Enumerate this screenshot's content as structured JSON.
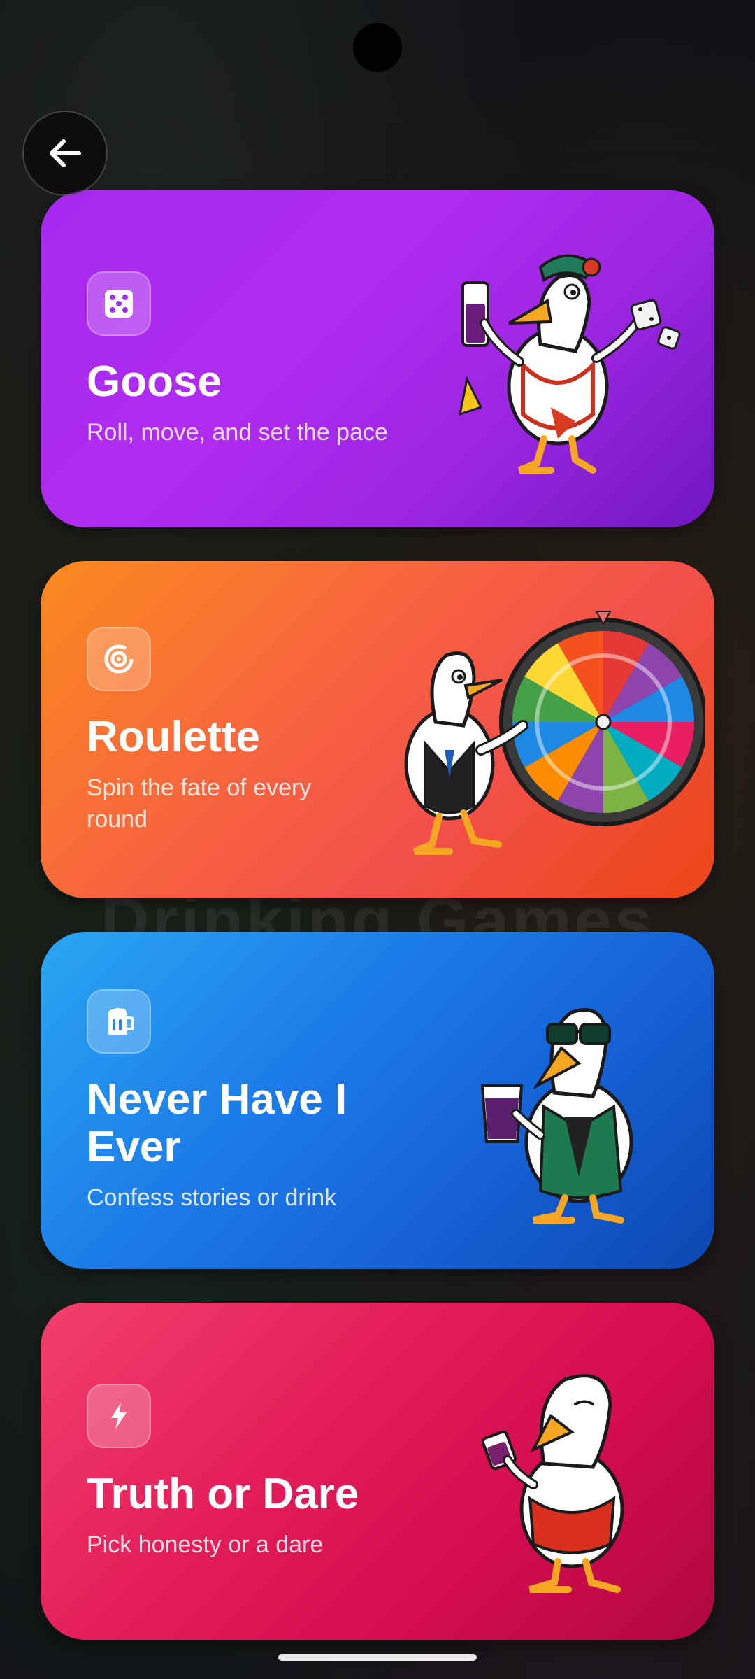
{
  "background_title": "Drinking Games",
  "back_button": {
    "icon": "arrow-left-icon"
  },
  "games": [
    {
      "title": "Goose",
      "subtitle": "Roll, move, and set the pace",
      "icon": "dice-icon",
      "mascot": "goose-with-drink-and-dice",
      "gradient": [
        "#a629ef",
        "#6f17c0"
      ]
    },
    {
      "title": "Roulette",
      "subtitle": "Spin the fate of every round",
      "icon": "target-icon",
      "mascot": "goose-pointing-at-wheel",
      "gradient": [
        "#fb8a1f",
        "#ec4615"
      ]
    },
    {
      "title": "Never Have I Ever",
      "subtitle": "Confess stories or drink",
      "icon": "beer-mug-icon",
      "mascot": "goose-with-sunglasses",
      "gradient": [
        "#2aa6f2",
        "#0c47b0"
      ]
    },
    {
      "title": "Truth or Dare",
      "subtitle": "Pick honesty or a dare",
      "icon": "lightning-icon",
      "mascot": "goose-embarrassed",
      "gradient": [
        "#f2406a",
        "#b0083e"
      ]
    }
  ]
}
